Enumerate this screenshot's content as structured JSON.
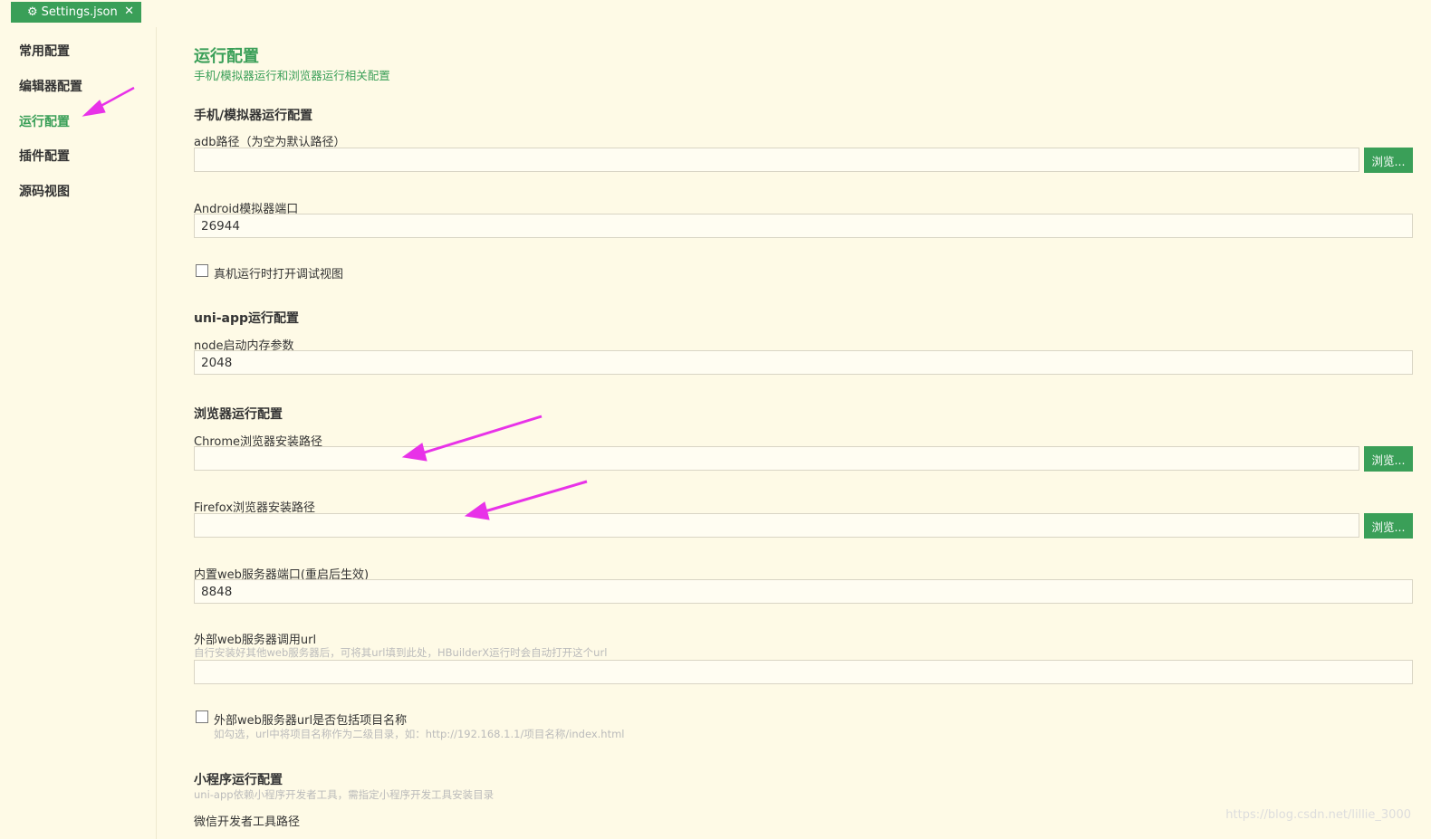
{
  "tab": {
    "icon": "gear-icon",
    "label": "Settings.json",
    "close": "✕"
  },
  "sidebar": {
    "items": [
      {
        "label": "常用配置",
        "active": false
      },
      {
        "label": "编辑器配置",
        "active": false
      },
      {
        "label": "运行配置",
        "active": true
      },
      {
        "label": "插件配置",
        "active": false
      },
      {
        "label": "源码视图",
        "active": false
      }
    ]
  },
  "main": {
    "title": "运行配置",
    "subtitle": "手机/模拟器运行和浏览器运行相关配置",
    "phone_section": "手机/模拟器运行配置",
    "adb_label": "adb路径（为空为默认路径）",
    "adb_value": "",
    "browse": "浏览...",
    "android_port_label": "Android模拟器端口",
    "android_port_value": "26944",
    "debug_view_label": "真机运行时打开调试视图",
    "uniapp_section": "uni-app运行配置",
    "node_mem_label": "node启动内存参数",
    "node_mem_value": "2048",
    "browser_section": "浏览器运行配置",
    "chrome_label": "Chrome浏览器安装路径",
    "chrome_value": "",
    "firefox_label": "Firefox浏览器安装路径",
    "firefox_value": "",
    "web_port_label": "内置web服务器端口(重启后生效)",
    "web_port_value": "8848",
    "ext_web_label": "外部web服务器调用url",
    "ext_web_hint": "自行安装好其他web服务器后，可将其url填到此处，HBuilderX运行时会自动打开这个url",
    "ext_web_value": "",
    "ext_include_label": "外部web服务器url是否包括项目名称",
    "ext_include_hint": "如勾选，url中将项目名称作为二级目录，如：http://192.168.1.1/项目名称/index.html",
    "mini_section": "小程序运行配置",
    "mini_hint": "uni-app依赖小程序开发者工具，需指定小程序开发工具安装目录",
    "wechat_label": "微信开发者工具路径"
  },
  "watermark": "https://blog.csdn.net/lillie_3000",
  "colors": {
    "accent": "#3a9f58",
    "background": "#fefae6",
    "annotation_arrow": "#e832e8"
  }
}
